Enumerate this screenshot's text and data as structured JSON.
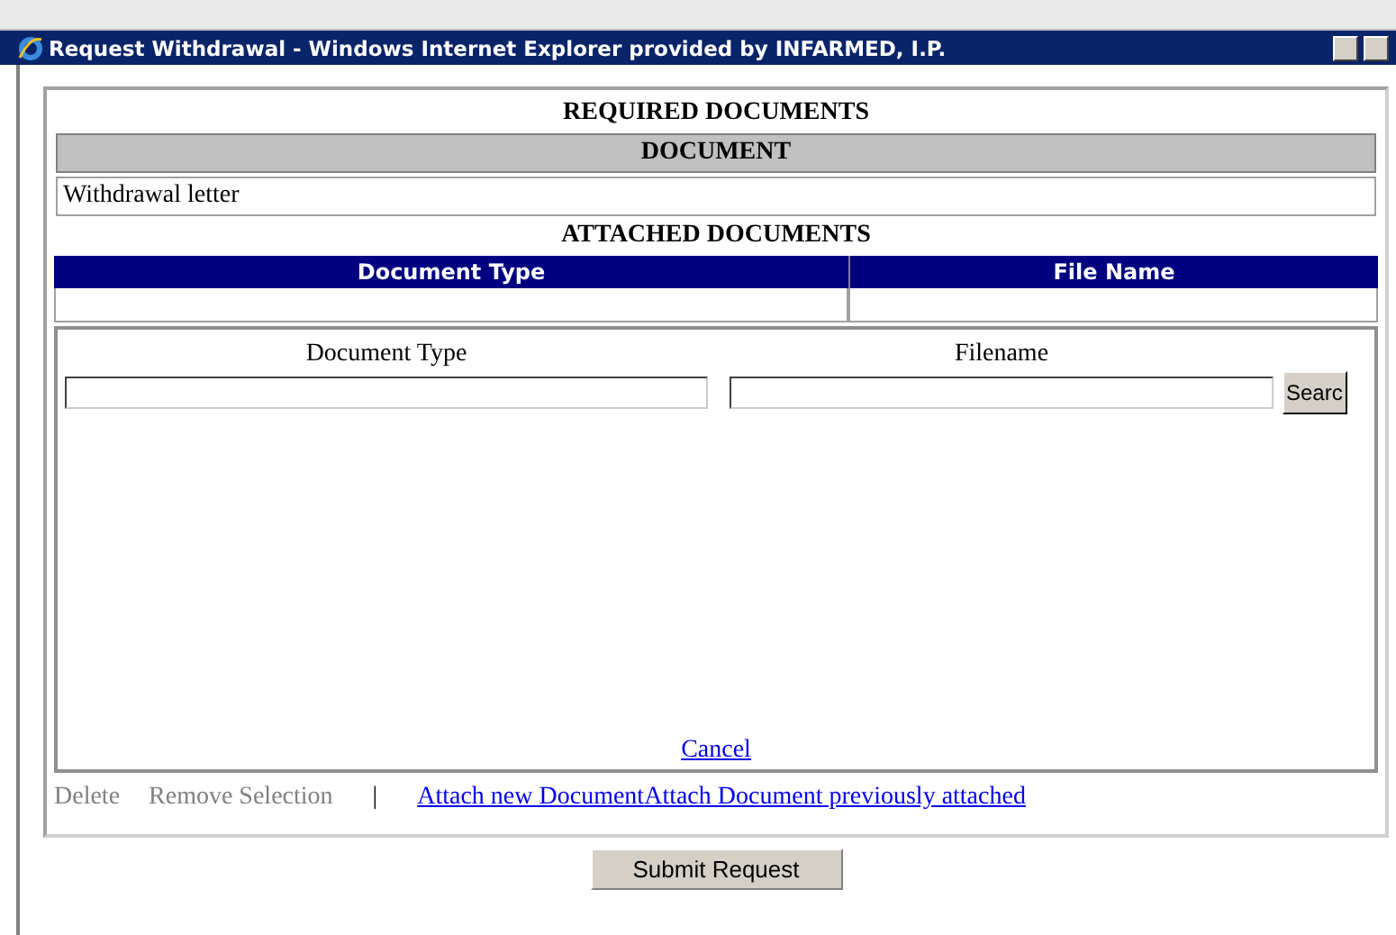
{
  "window": {
    "title": "Request Withdrawal - Windows Internet Explorer provided by INFARMED, I.P."
  },
  "required": {
    "title": "REQUIRED DOCUMENTS",
    "column": "DOCUMENT",
    "rows": [
      "Withdrawal letter"
    ]
  },
  "attached": {
    "title": "ATTACHED DOCUMENTS",
    "columns": [
      "Document Type",
      "File Name"
    ]
  },
  "form": {
    "doc_type_label": "Document Type",
    "filename_label": "Filename",
    "search_button": "Searc",
    "cancel": "Cancel"
  },
  "actions": [
    {
      "label": "Delete",
      "disabled": true
    },
    {
      "label": "Remove Selection",
      "disabled": true
    }
  ],
  "separator": "|",
  "links": [
    "Attach new Document",
    "Attach Document previously attached"
  ],
  "submit": "Submit Request"
}
